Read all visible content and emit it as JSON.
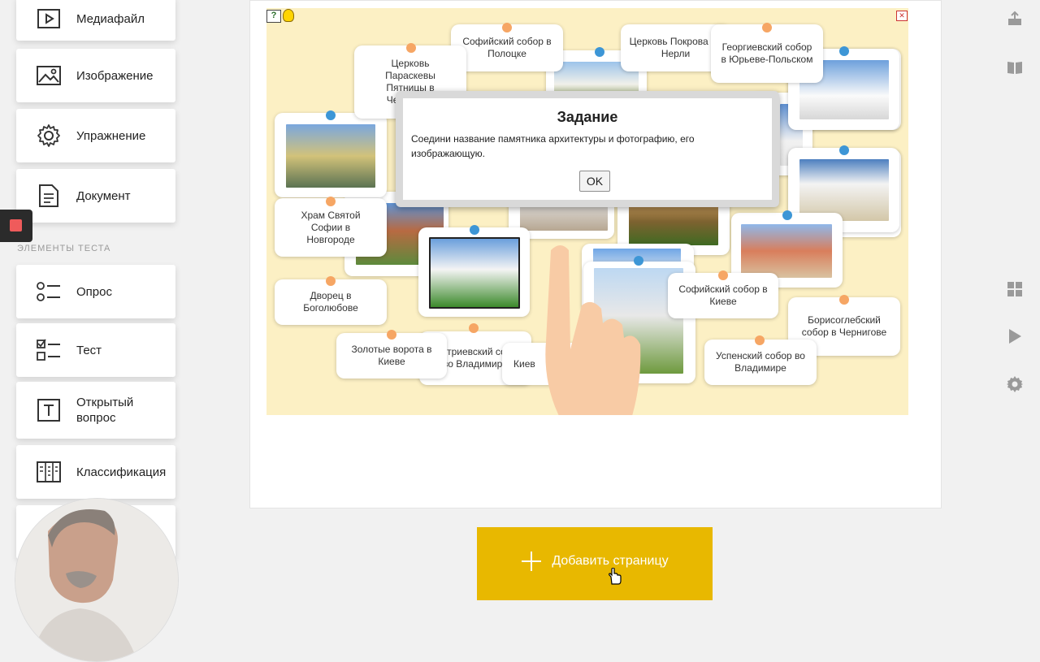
{
  "palette": {
    "items": [
      {
        "label": "Медиафайл",
        "icon": "media-file-icon"
      },
      {
        "label": "Изображение",
        "icon": "image-icon"
      },
      {
        "label": "Упражнение",
        "icon": "gear-icon"
      },
      {
        "label": "Документ",
        "icon": "document-icon"
      }
    ],
    "section_label": "ЭЛЕМЕНТЫ ТЕСТА",
    "test_items": [
      {
        "label": "Опрос",
        "icon": "poll-icon"
      },
      {
        "label": "Тест",
        "icon": "checklist-icon"
      },
      {
        "label": "Открытый вопрос",
        "icon": "open-question-icon"
      },
      {
        "label": "Классификация",
        "icon": "classification-icon"
      }
    ]
  },
  "exercise": {
    "labels": [
      "Софийский собор в Полоцке",
      "Церковь Покрова на Нерли",
      "Георгиевский собор в Юрьеве-Польском",
      "Церковь Параскевы Пятницы в Чернигове",
      "Храм Святой Софии в Новгороде",
      "Дворец в Боголюбове",
      "Золотые ворота в Киеве",
      "Дмитриевский собор во Владимире",
      "Киев",
      "Софийский собор в Киеве",
      "Борисоглебский собор в Чернигове",
      "Успенский собор во Владимире"
    ],
    "dialog": {
      "title": "Задание",
      "text": "Соедини название памятника архитектуры и фотографию, его изображающую.",
      "ok": "OK"
    },
    "icons": {
      "help": "help-icon",
      "hint": "lightbulb-icon",
      "fullscreen": "fullscreen-icon"
    }
  },
  "add_page": {
    "label": "Добавить страницу"
  },
  "right_rail": [
    "share-icon",
    "book-icon",
    "grid-icon",
    "play-icon",
    "settings-icon"
  ],
  "colors": {
    "accent": "#e8b800",
    "canvas": "#fcf0c4",
    "dot_orange": "#f6a664",
    "dot_blue": "#3d96d6"
  }
}
